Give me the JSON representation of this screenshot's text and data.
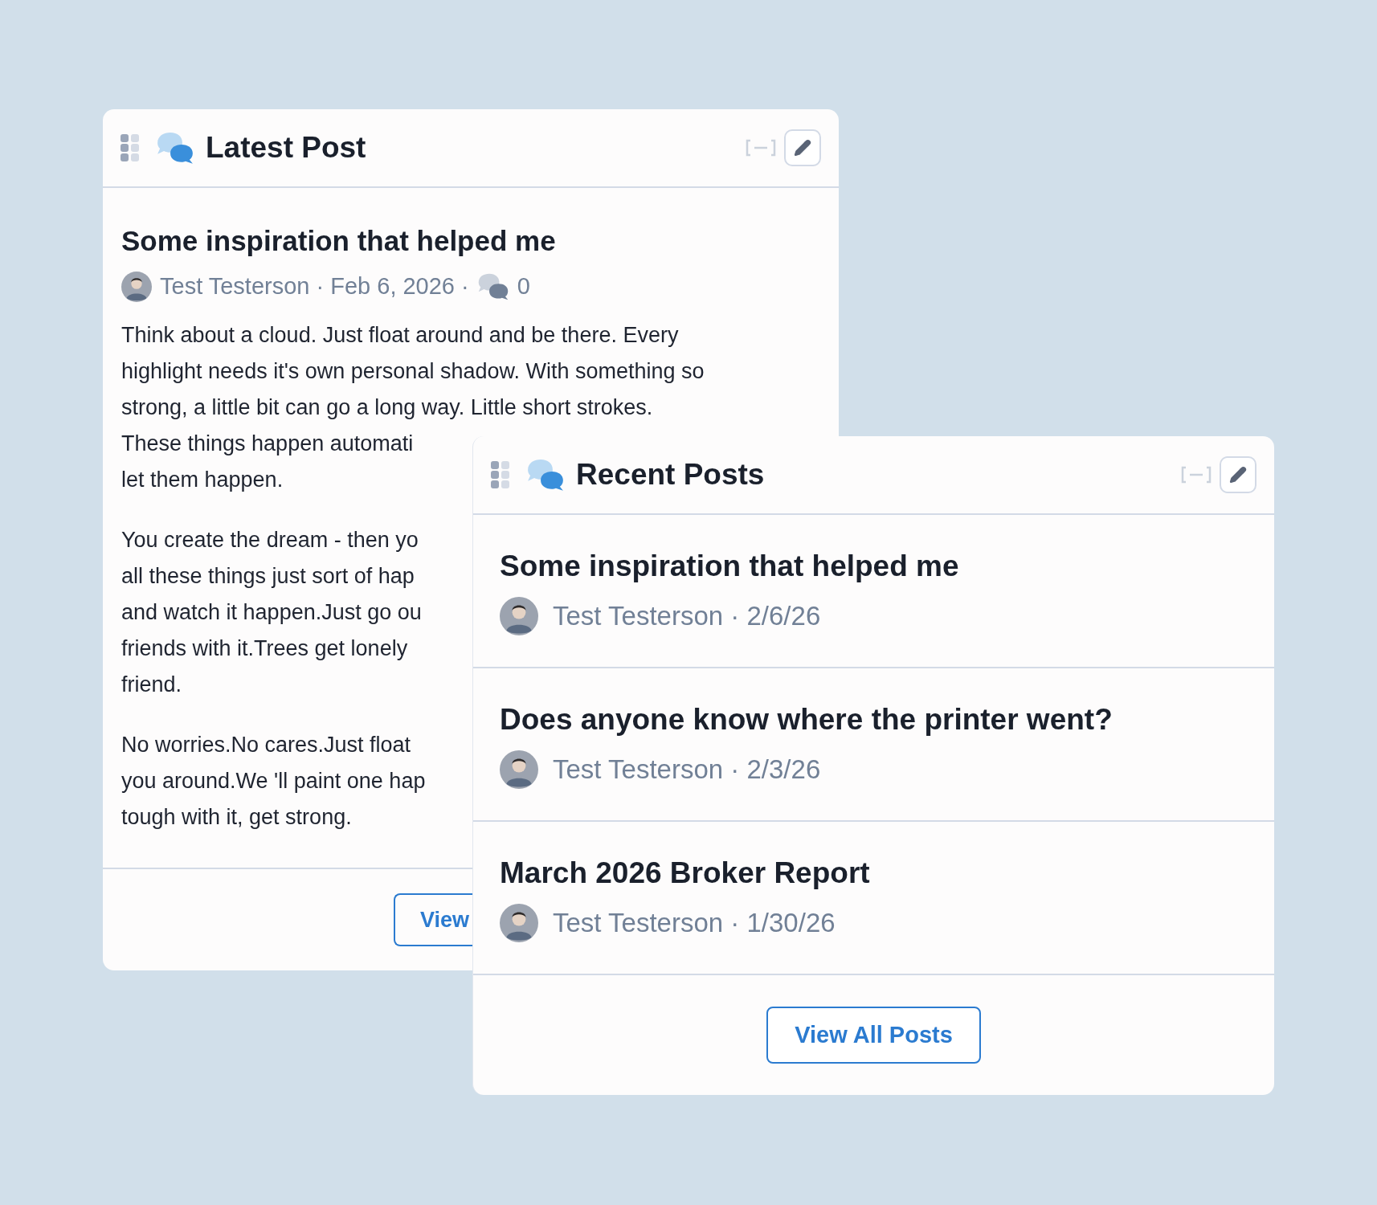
{
  "latest_post": {
    "title": "Latest Post",
    "post_title": "Some inspiration that helped me",
    "byline": "Test Testerson · Feb 6, 2026 ·",
    "comment_count": "0",
    "paragraphs": [
      [
        "Think about a cloud. Just float around and be there. Every",
        "highlight needs it's own personal shadow. With something so",
        "strong, a little bit can go a long way. Little short strokes.",
        "These things happen automati",
        "let them happen."
      ],
      [
        "You create the dream - then yo",
        "all these things just sort of hap",
        "and watch it happen.Just go ou",
        "friends with it.Trees get lonely",
        "friend."
      ],
      [
        "No worries.No cares.Just float",
        "you around.We 'll paint one hap",
        "tough with it, get strong."
      ]
    ],
    "button": "View"
  },
  "recent_posts": {
    "title": "Recent Posts",
    "posts": [
      {
        "title": "Some inspiration that helped me",
        "byline": "Test Testerson · 2/6/26"
      },
      {
        "title": "Does anyone know where the printer went?",
        "byline": "Test Testerson · 2/3/26"
      },
      {
        "title": "March 2026 Broker Report",
        "byline": "Test Testerson · 1/30/26"
      }
    ],
    "button": "View All Posts"
  }
}
